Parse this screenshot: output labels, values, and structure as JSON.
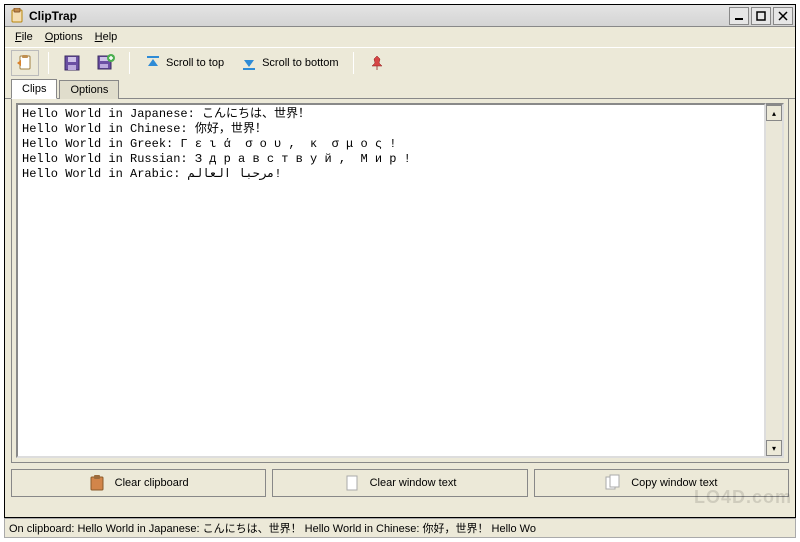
{
  "window": {
    "title": "ClipTrap"
  },
  "menubar": {
    "file": "File",
    "options": "Options",
    "help": "Help"
  },
  "toolbar": {
    "scroll_top": "Scroll to top",
    "scroll_bottom": "Scroll to bottom"
  },
  "tabs": {
    "clips": "Clips",
    "options": "Options"
  },
  "text_lines": [
    "Hello World in Japanese: こんにちは、世界！",
    "Hello World in Chinese: 你好，世界！",
    "Hello World in Greek: Γ ε ι ά  σ ο υ ,  κ  σ μ ο ς !",
    "Hello World in Russian: З д р а в с т в у й ,  М и р !",
    "Hello World in Arabic: مرحبا العالم!"
  ],
  "buttons": {
    "clear_clipboard": "Clear clipboard",
    "clear_window": "Clear window text",
    "copy_window": "Copy window text"
  },
  "statusbar": {
    "text": "On clipboard: Hello World in Japanese: こんにちは、世界！   Hello World in Chinese: 你好，世界！   Hello Wo"
  },
  "watermark": "LO4D.com"
}
